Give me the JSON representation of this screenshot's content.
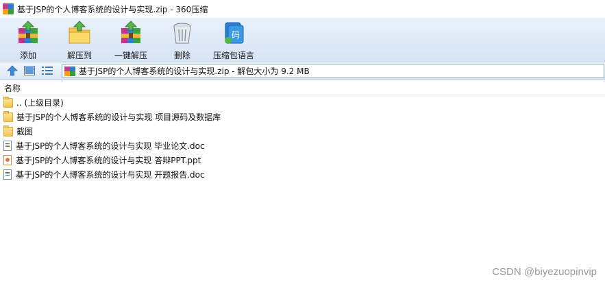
{
  "window": {
    "title": "基于JSP的个人博客系统的设计与实现.zip - 360压缩"
  },
  "toolbar": {
    "add_label": "添加",
    "extract_to_label": "解压到",
    "one_click_extract_label": "一键解压",
    "delete_label": "删除",
    "compress_lang_label": "压缩包语言"
  },
  "address": {
    "path": "基于JSP的个人博客系统的设计与实现.zip - 解包大小为 9.2 MB"
  },
  "list": {
    "column_name": "名称",
    "items": [
      {
        "type": "folder",
        "name": ".. (上级目录)"
      },
      {
        "type": "folder",
        "name": "基于JSP的个人博客系统的设计与实现 项目源码及数据库"
      },
      {
        "type": "folder",
        "name": "截图"
      },
      {
        "type": "doc",
        "name": "基于JSP的个人博客系统的设计与实现 毕业论文.doc"
      },
      {
        "type": "ppt",
        "name": "基于JSP的个人博客系统的设计与实现 答辩PPT.ppt"
      },
      {
        "type": "doc",
        "name": "基于JSP的个人博客系统的设计与实现 开题报告.doc"
      }
    ]
  },
  "watermark": "CSDN @biyezuopinvip"
}
